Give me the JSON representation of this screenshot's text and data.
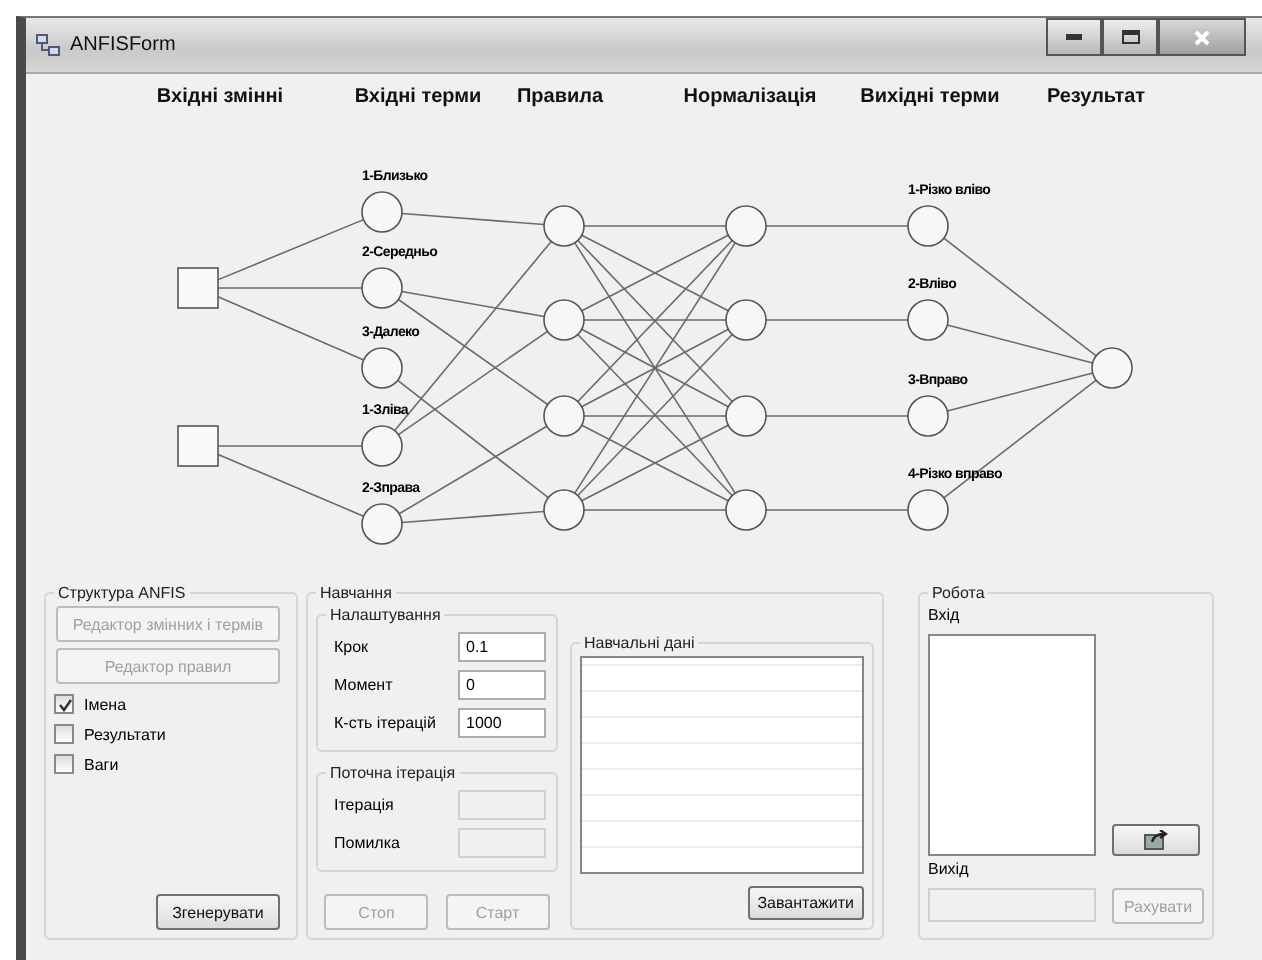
{
  "window": {
    "title": "ANFISForm"
  },
  "layers": [
    "Вхідні змінні",
    "Вхідні терми",
    "Правила",
    "Нормалізація",
    "Вихідні терми",
    "Результат"
  ],
  "diagram": {
    "input_terms": [
      "1-Близько",
      "2-Середньо",
      "3-Далеко",
      "1-Зліва",
      "2-Зправа"
    ],
    "output_terms": [
      "1-Різко вліво",
      "2-Вліво",
      "3-Вправо",
      "4-Різко вправо"
    ]
  },
  "structure": {
    "title": "Структура ANFIS",
    "buttons": [
      {
        "label": "Редактор змінних і термів",
        "disabled": true
      },
      {
        "label": "Редактор правил",
        "disabled": true
      }
    ],
    "checkboxes": [
      {
        "label": "Імена",
        "checked": true
      },
      {
        "label": "Результати",
        "checked": false
      },
      {
        "label": "Ваги",
        "checked": false
      }
    ],
    "generate": {
      "label": "Згенерувати",
      "disabled": false
    }
  },
  "training": {
    "title": "Навчання",
    "settings": {
      "title": "Налаштування",
      "fields": [
        {
          "label": "Крок",
          "value": "0.1",
          "disabled": false
        },
        {
          "label": "Момент",
          "value": "0",
          "disabled": false
        },
        {
          "label": "К-сть ітерацій",
          "value": "1000",
          "disabled": false
        }
      ]
    },
    "current": {
      "title": "Поточна ітерація",
      "fields": [
        {
          "label": "Ітерація",
          "disabled": true
        },
        {
          "label": "Помилка",
          "disabled": true
        }
      ]
    },
    "buttons": [
      {
        "label": "Стоп",
        "disabled": true
      },
      {
        "label": "Старт",
        "disabled": true
      }
    ],
    "data": {
      "title": "Навчальні дані",
      "load": {
        "label": "Завантажити",
        "disabled": false
      }
    }
  },
  "work": {
    "title": "Робота",
    "input_label": "Вхід",
    "output_label": "Вихід",
    "output_disabled": true,
    "run": {
      "label": "Рахувати",
      "disabled": true
    }
  }
}
